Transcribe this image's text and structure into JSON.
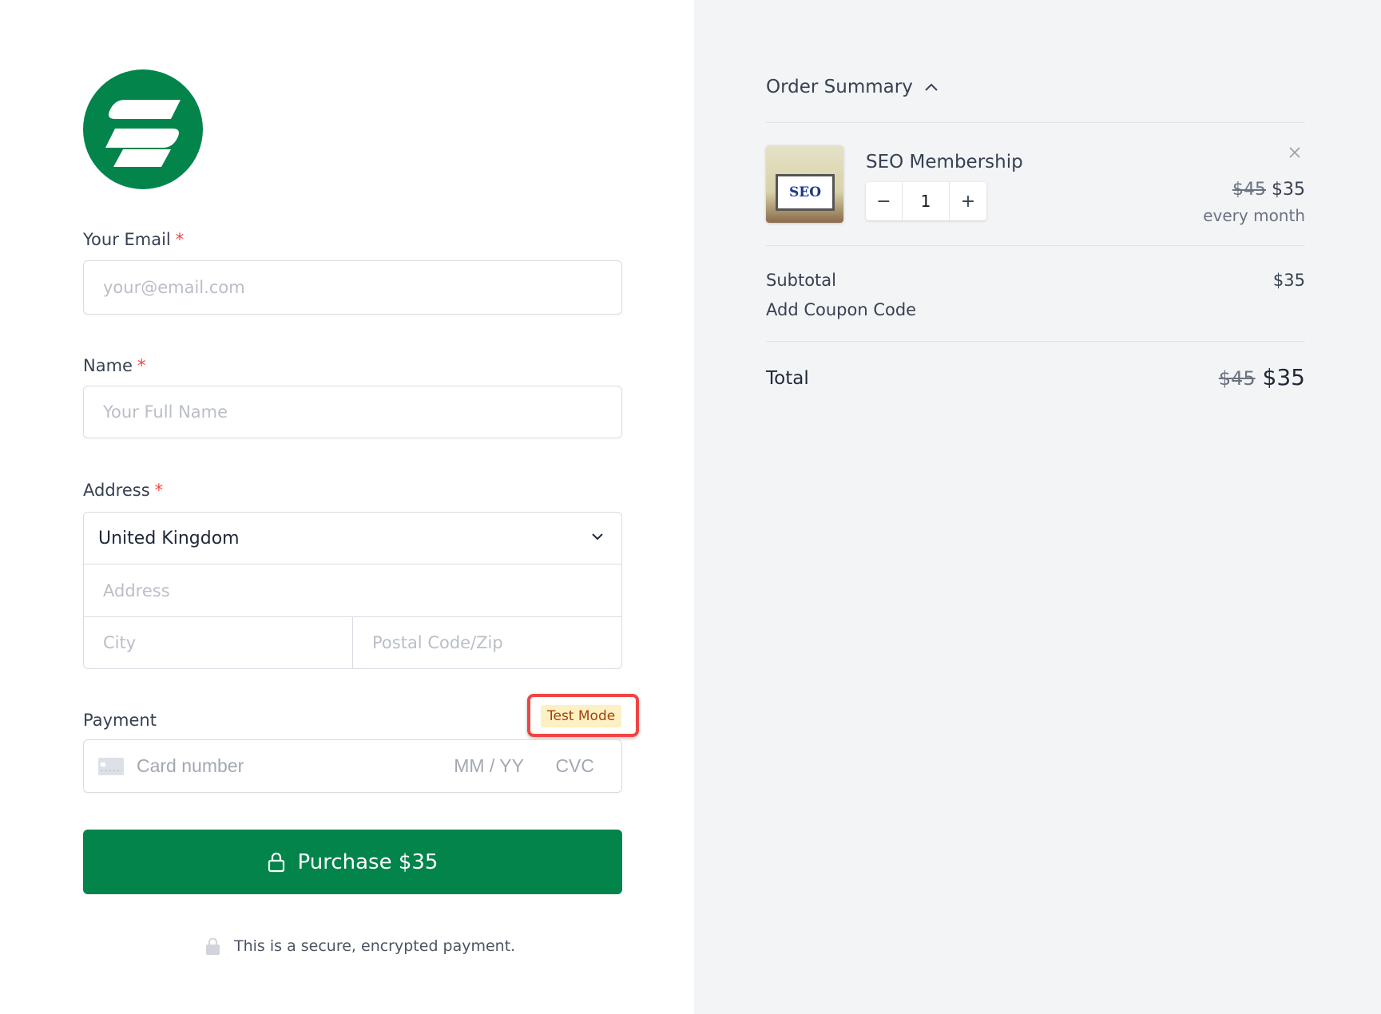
{
  "brand": {
    "color": "#02844b"
  },
  "form": {
    "email": {
      "label": "Your Email",
      "required": "*",
      "placeholder": "your@email.com"
    },
    "name": {
      "label": "Name",
      "required": "*",
      "placeholder": "Your Full Name"
    },
    "address": {
      "label": "Address",
      "required": "*",
      "country": "United Kingdom",
      "address_placeholder": "Address",
      "city_placeholder": "City",
      "postal_placeholder": "Postal Code/Zip"
    },
    "payment": {
      "label": "Payment",
      "test_mode": "Test Mode",
      "card_placeholder": "Card number",
      "expiry_placeholder": "MM / YY",
      "cvc_placeholder": "CVC"
    },
    "purchase_label": "Purchase $35",
    "secure_note": "This is a secure, encrypted payment."
  },
  "summary": {
    "title": "Order Summary",
    "item": {
      "name": "SEO Membership",
      "quantity": "1",
      "original_price": "$45",
      "price": "$35",
      "interval": "every month",
      "image_text": "SEO"
    },
    "subtotal_label": "Subtotal",
    "subtotal": "$35",
    "coupon_label": "Add Coupon Code",
    "total_label": "Total",
    "total_original": "$45",
    "total": "$35"
  }
}
